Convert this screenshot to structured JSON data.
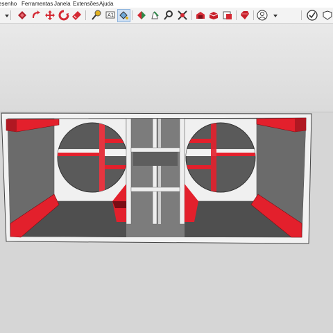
{
  "menu": {
    "items": [
      {
        "label": "esenho"
      },
      {
        "label": "Ferramentas"
      },
      {
        "label": "Janela"
      },
      {
        "label": "Extensões"
      },
      {
        "label": "Ajuda"
      }
    ]
  },
  "toolbar": {
    "icons": [
      "dropdown-arrow-icon",
      "move-icon",
      "rotate-icon",
      "move-arrows-icon",
      "follow-me-icon",
      "tape-measure-icon",
      "text-icon",
      "paint-bucket-icon",
      "orbit-icon",
      "pan-icon",
      "zoom-icon",
      "zoom-extents-icon",
      "warehouse-icon",
      "extension-warehouse-icon",
      "layout-icon",
      "ruby-icon",
      "user-account-icon",
      "check-circle-icon",
      "solid-inspector-icon"
    ]
  },
  "colors": {
    "accent_red": "#e3202c",
    "panel_white": "#f4f4f4",
    "inner_gray": "#6b6b6b",
    "viewport_bg": "#d9d9d9"
  },
  "model": {
    "name": "subwoofer-box"
  }
}
